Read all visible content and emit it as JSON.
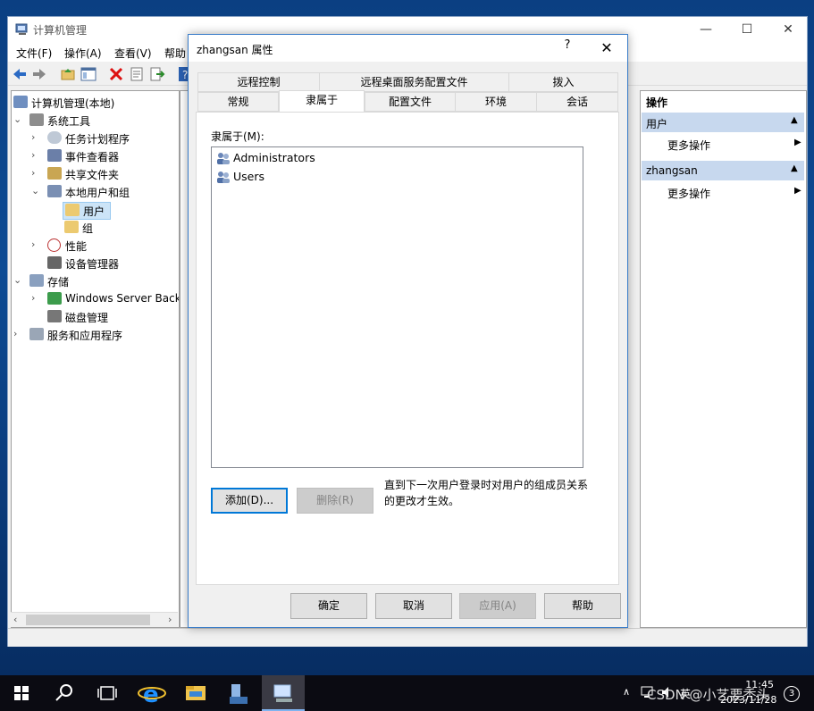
{
  "desktop": {
    "main_window": {
      "title": "计算机管理",
      "menus": [
        "文件(F)",
        "操作(A)",
        "查看(V)",
        "帮助"
      ],
      "tree": [
        {
          "label": "计算机管理(本地)",
          "level": 0
        },
        {
          "label": "系统工具",
          "level": 1
        },
        {
          "label": "任务计划程序",
          "level": 2
        },
        {
          "label": "事件查看器",
          "level": 2
        },
        {
          "label": "共享文件夹",
          "level": 2
        },
        {
          "label": "本地用户和组",
          "level": 2
        },
        {
          "label": "用户",
          "level": 3
        },
        {
          "label": "组",
          "level": 3
        },
        {
          "label": "性能",
          "level": 2
        },
        {
          "label": "设备管理器",
          "level": 2
        },
        {
          "label": "存储",
          "level": 1
        },
        {
          "label": "Windows Server Back",
          "level": 2
        },
        {
          "label": "磁盘管理",
          "level": 2
        },
        {
          "label": "服务和应用程序",
          "level": 1
        }
      ],
      "actions": {
        "header": "操作",
        "groups": [
          {
            "title": "用户",
            "items": [
              "更多操作"
            ]
          },
          {
            "title": "zhangsan",
            "items": [
              "更多操作"
            ]
          }
        ]
      }
    },
    "dialog": {
      "title": "zhangsan 属性",
      "help_symbol": "?",
      "close_symbol": "✕",
      "tabs_row1": [
        "远程控制",
        "远程桌面服务配置文件",
        "拨入"
      ],
      "tabs_row2": [
        "常规",
        "隶属于",
        "配置文件",
        "环境",
        "会话"
      ],
      "active_tab": "隶属于",
      "member_label": "隶属于(M):",
      "members": [
        "Administrators",
        "Users"
      ],
      "add_button": "添加(D)...",
      "remove_button": "删除(R)",
      "note": "直到下一次用户登录时对用户的组成员关系的更改才生效。",
      "ok_button": "确定",
      "cancel_button": "取消",
      "apply_button": "应用(A)",
      "help_button": "帮助"
    }
  },
  "taskbar": {
    "time": "11:45",
    "date": "2023/11/28",
    "ime": "英",
    "watermark": "CSDN @小艺要秃头",
    "notification_count": "3"
  },
  "colors": {
    "accent": "#0078d7",
    "selection": "#cce4f7",
    "action_group": "#c7d8ee"
  }
}
